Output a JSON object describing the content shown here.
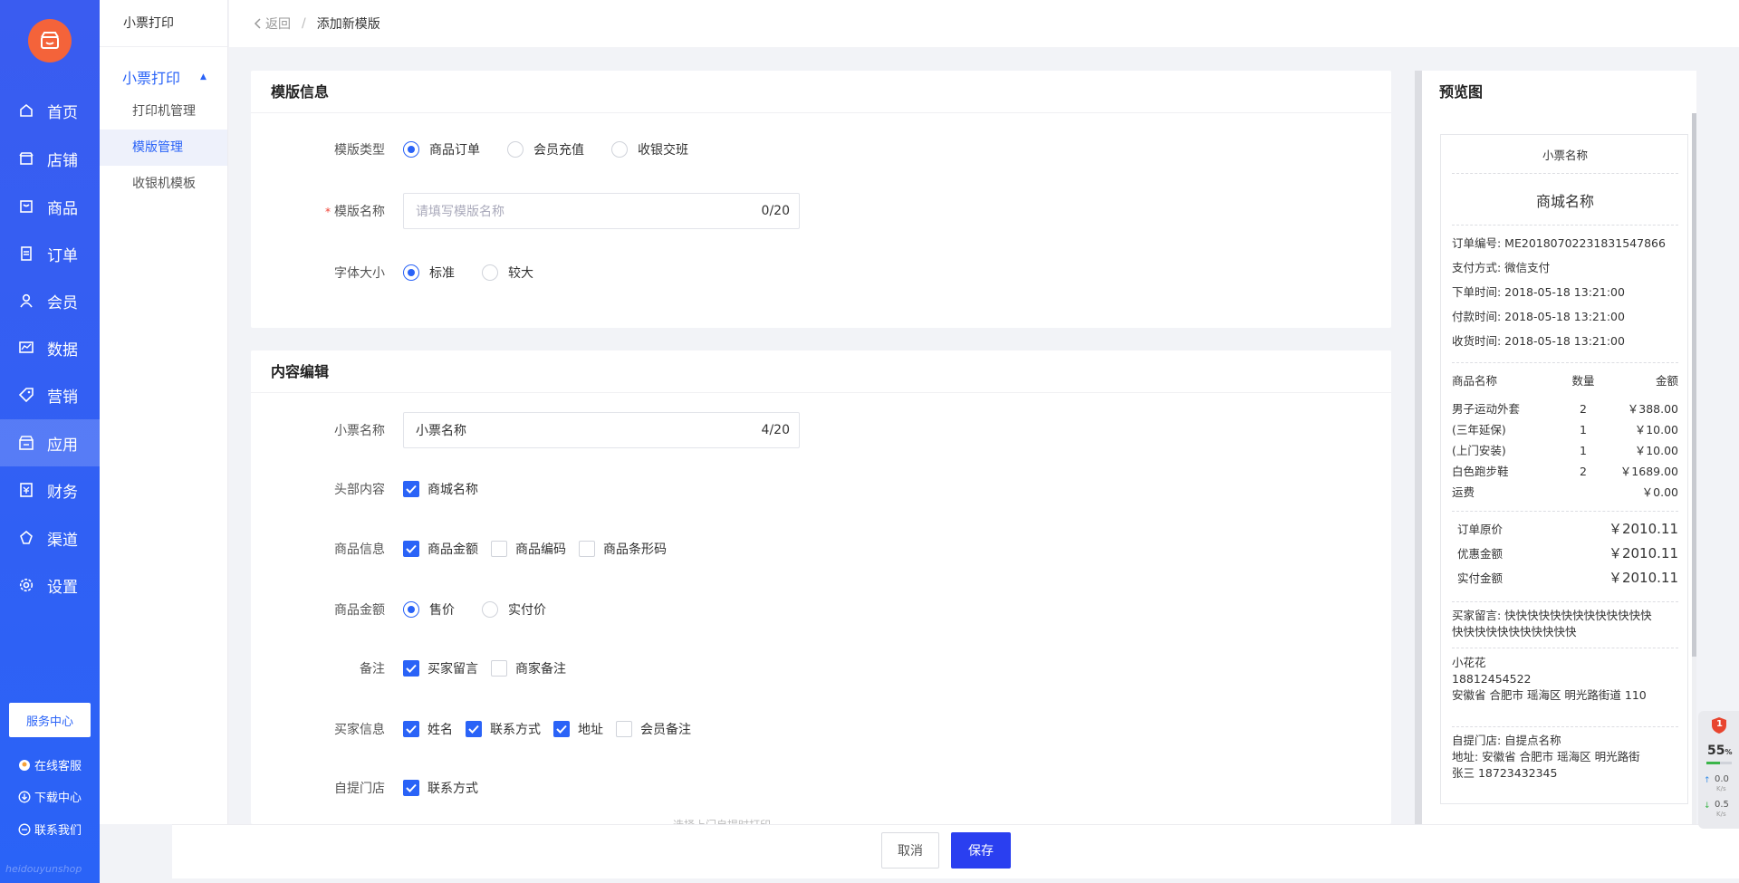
{
  "sidebar": {
    "items": [
      {
        "label": "首页",
        "icon": "home-icon"
      },
      {
        "label": "店铺",
        "icon": "store-icon"
      },
      {
        "label": "商品",
        "icon": "goods-icon"
      },
      {
        "label": "订单",
        "icon": "order-icon"
      },
      {
        "label": "会员",
        "icon": "member-icon"
      },
      {
        "label": "数据",
        "icon": "chart-icon"
      },
      {
        "label": "营销",
        "icon": "tag-icon"
      },
      {
        "label": "应用",
        "icon": "app-icon"
      },
      {
        "label": "财务",
        "icon": "finance-icon"
      },
      {
        "label": "渠道",
        "icon": "channel-icon"
      },
      {
        "label": "设置",
        "icon": "gear-icon"
      }
    ],
    "active": "应用",
    "service_center": "服务中心",
    "links": {
      "online_service": "在线客服",
      "download_center": "下载中心",
      "contact_us": "联系我们"
    },
    "brand_mark": "heidouyunshop"
  },
  "subbar": {
    "title": "小票打印",
    "group": "小票打印",
    "items": [
      "打印机管理",
      "模版管理",
      "收银机模板"
    ],
    "active": "模版管理"
  },
  "header": {
    "back": "返回",
    "sep": "/",
    "crumb": "添加新模版"
  },
  "template_info": {
    "title": "模版信息",
    "type_label": "模版类型",
    "type_options": [
      "商品订单",
      "会员充值",
      "收银交班"
    ],
    "name_label": "模版名称",
    "name_placeholder": "请填写模版名称",
    "name_count": "0/20",
    "font_label": "字体大小",
    "font_options": [
      "标准",
      "较大"
    ]
  },
  "content_edit": {
    "title": "内容编辑",
    "ticket_name_label": "小票名称",
    "ticket_name_value": "小票名称",
    "ticket_name_count": "4/20",
    "header_label": "头部内容",
    "header_option": "商城名称",
    "goods_info_label": "商品信息",
    "goods_info_options": [
      "商品金额",
      "商品编码",
      "商品条形码"
    ],
    "goods_amount_label": "商品金额",
    "goods_amount_options": [
      "售价",
      "实付价"
    ],
    "remark_label": "备注",
    "remark_options": [
      "买家留言",
      "商家备注"
    ],
    "buyer_label": "买家信息",
    "buyer_options": [
      "姓名",
      "联系方式",
      "地址",
      "会员备注"
    ],
    "pickup_label": "自提门店",
    "pickup_option": "联系方式",
    "pickup_hint": "选择上门自提时打印"
  },
  "preview": {
    "title": "预览图",
    "ticket_title": "小票名称",
    "shop_name": "商城名称",
    "order_info": [
      "订单编号:  ME20180702231831547866",
      "支付方式:  微信支付",
      "下单时间:  2018-05-18 13:21:00",
      "付款时间:  2018-05-18 13:21:00",
      "收货时间:  2018-05-18 13:21:00"
    ],
    "table_headers": [
      "商品名称",
      "数量",
      "金额"
    ],
    "table_rows": [
      [
        "男子运动外套",
        "2",
        "￥388.00"
      ],
      [
        "(三年延保)",
        "1",
        "￥10.00"
      ],
      [
        "(上门安装)",
        "1",
        "￥10.00"
      ],
      [
        "白色跑步鞋",
        "2",
        "￥1689.00"
      ],
      [
        "运费",
        "",
        "￥0.00"
      ]
    ],
    "summary": [
      [
        "订单原价",
        "￥2010.11"
      ],
      [
        "优惠金额",
        "￥2010.11"
      ],
      [
        "实付金额",
        "￥2010.11"
      ]
    ],
    "buyer_msg_line1": "买家留言: 快快快快快快快快快快快快快",
    "buyer_msg_line2": "快快快快快快快快快快快",
    "buyer_name": "小花花",
    "buyer_phone": "18812454522",
    "buyer_addr": "安徽省 合肥市 瑶海区 明光路街道 110",
    "store_name": "自提门店:  自提点名称",
    "store_addr": "地址:  安徽省 合肥市 瑶海区 明光路街",
    "store_contact": "张三 18723432345"
  },
  "footer": {
    "cancel": "取消",
    "save": "保存"
  },
  "monitor": {
    "badge": "1",
    "percent": "55",
    "percent_unit": "%",
    "up": "0.0",
    "down": "0.5",
    "unit": "K/s"
  }
}
